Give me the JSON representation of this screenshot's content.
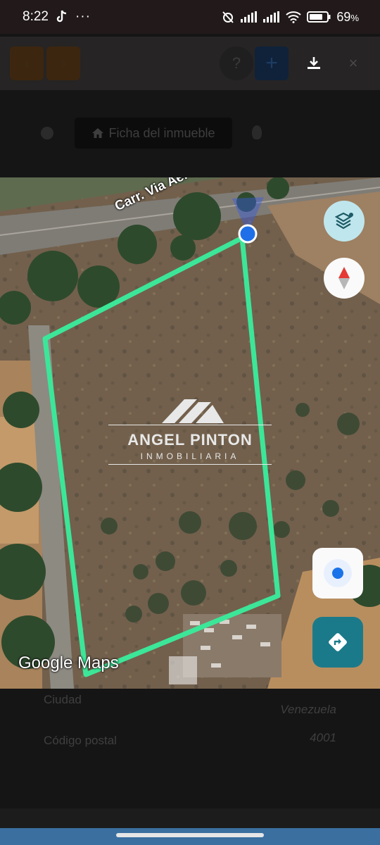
{
  "status_bar": {
    "time": "8:22",
    "notification_icons": [
      "tiktok-icon",
      "more-icon"
    ],
    "system_icons": [
      "alarm-off-icon",
      "signal-icon",
      "signal-icon",
      "wifi-icon",
      "battery-icon"
    ],
    "battery_percent": "69",
    "percent_symbol": "%"
  },
  "toolbar": {
    "prev_icon": "‹",
    "next_icon": "›",
    "help_icon": "?",
    "add_icon": "+",
    "close_icon": "×"
  },
  "ficha": {
    "label": "Ficha del inmueble"
  },
  "map": {
    "road_label": "Carr. Via Aerop",
    "watermark": {
      "name": "ANGEL PINTON",
      "subtitle": "INMOBILIARIA"
    },
    "attribution": "Google Maps",
    "boundary_color": "#3ce698",
    "location_color": "#1f6fe8"
  },
  "details": {
    "rows": [
      {
        "label": "Ciudad",
        "value": "Venezuela"
      },
      {
        "label": "Código postal",
        "value": "4001"
      }
    ]
  }
}
